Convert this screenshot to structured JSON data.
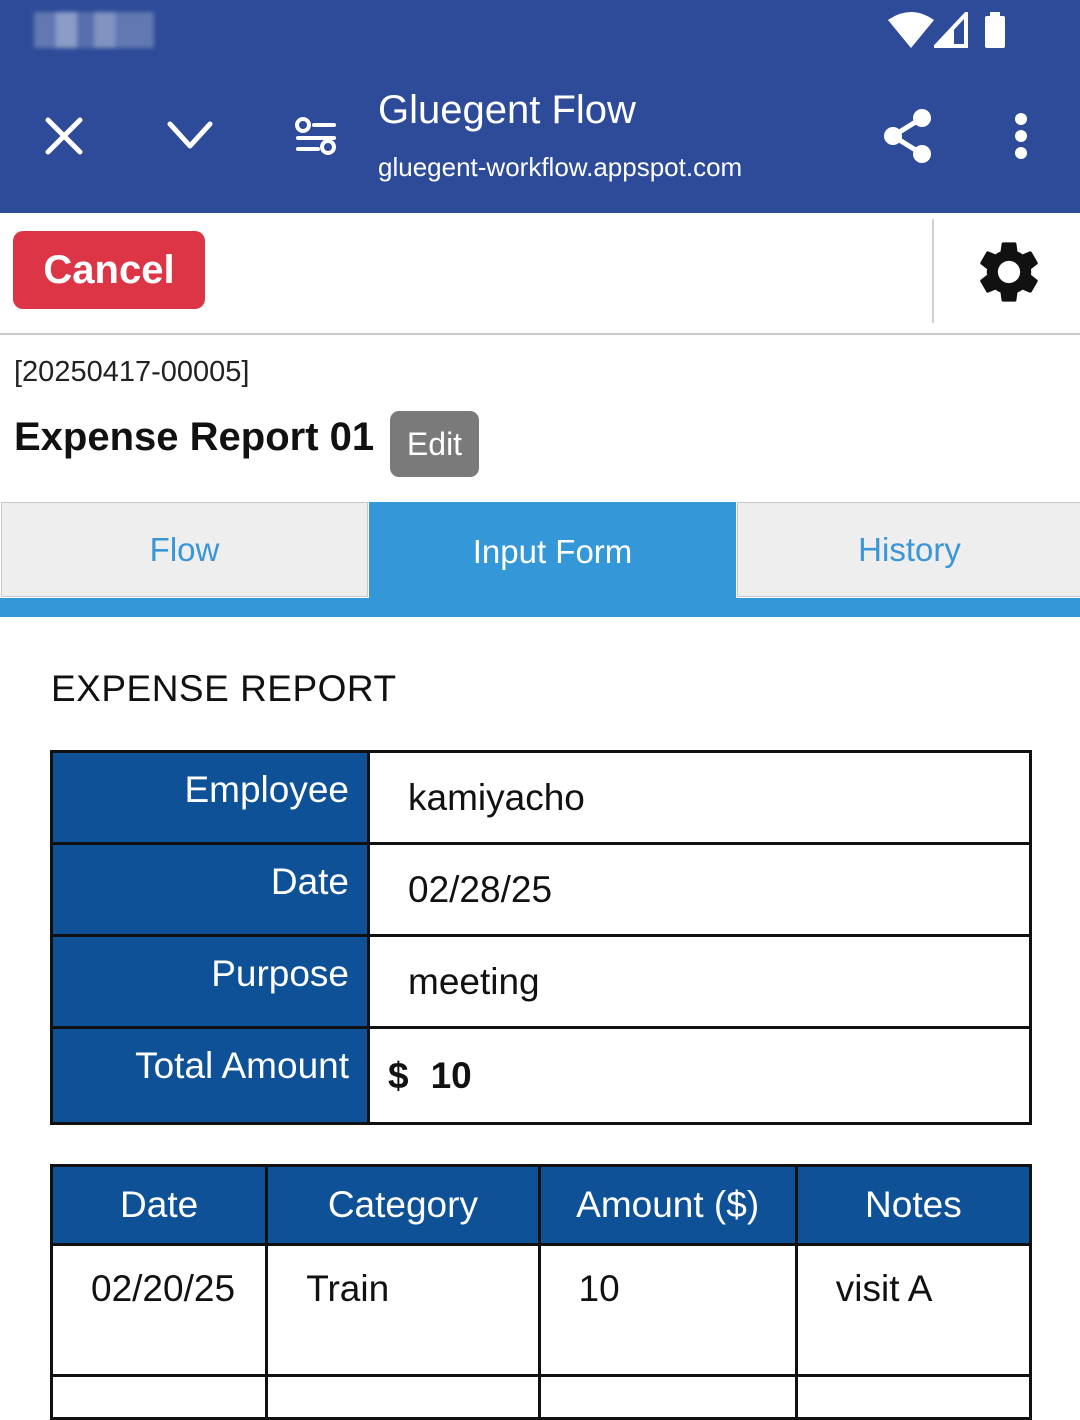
{
  "browser": {
    "site_title": "Gluegent Flow",
    "site_url": "gluegent-workflow.appspot.com",
    "icons": [
      "close-icon",
      "chevron-down-icon",
      "tune-icon",
      "share-icon",
      "more-vert-icon"
    ],
    "status_icons": [
      "wifi-icon",
      "signal-icon",
      "battery-icon"
    ]
  },
  "toolbar": {
    "cancel_label": "Cancel",
    "settings_icon": "gear-icon"
  },
  "document": {
    "id": "[20250417-00005]",
    "title": "Expense Report 01",
    "edit_label": "Edit"
  },
  "tabs": [
    {
      "label": "Flow",
      "active": false
    },
    {
      "label": "Input Form",
      "active": true
    },
    {
      "label": "History",
      "active": false
    }
  ],
  "form": {
    "heading": "EXPENSE REPORT",
    "summary": {
      "employee_label": "Employee",
      "employee_value": "kamiyacho",
      "date_label": "Date",
      "date_value": "02/28/25",
      "purpose_label": "Purpose",
      "purpose_value": "meeting",
      "total_label": "Total Amount",
      "currency": "$",
      "total_value": "10"
    },
    "items": {
      "headers": [
        "Date",
        "Category",
        "Amount ($)",
        "Notes"
      ],
      "rows": [
        {
          "date": "02/20/25",
          "category": "Train",
          "amount": "10",
          "notes": "visit A"
        }
      ]
    }
  },
  "colors": {
    "chrome": "#2d4b98",
    "cancel": "#dc3545",
    "tab_active": "#3497d8",
    "table_header": "#0e5196"
  }
}
